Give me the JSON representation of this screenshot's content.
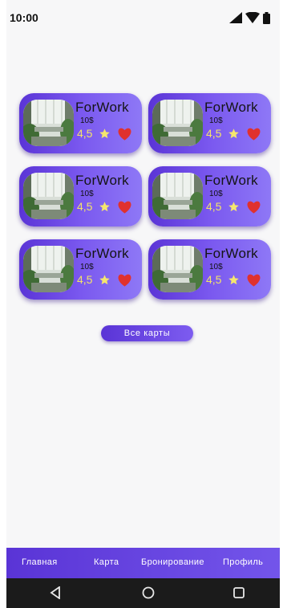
{
  "status_bar": {
    "time": "10:00",
    "icons": [
      "signal-icon",
      "wifi-icon",
      "battery-icon"
    ]
  },
  "cards": [
    {
      "title": "ForWork",
      "price": "10$",
      "rating": "4,5",
      "favorite": true
    },
    {
      "title": "ForWork",
      "price": "10$",
      "rating": "4,5",
      "favorite": true
    },
    {
      "title": "ForWork",
      "price": "10$",
      "rating": "4,5",
      "favorite": true
    },
    {
      "title": "ForWork",
      "price": "10$",
      "rating": "4,5",
      "favorite": true
    },
    {
      "title": "ForWork",
      "price": "10$",
      "rating": "4,5",
      "favorite": true
    },
    {
      "title": "ForWork",
      "price": "10$",
      "rating": "4,5",
      "favorite": true
    }
  ],
  "all_cards_button": "Все карты",
  "bottom_nav": {
    "items": [
      {
        "label": "Главная"
      },
      {
        "label": "Карта"
      },
      {
        "label": "Бронирование"
      },
      {
        "label": "Профиль"
      }
    ]
  },
  "system_nav": [
    "back-icon",
    "home-icon",
    "recents-icon"
  ],
  "colors": {
    "accent": "#5a34d6",
    "accent_light": "#8e78f6",
    "rating": "#f3e36a",
    "heart": "#e0312e"
  }
}
